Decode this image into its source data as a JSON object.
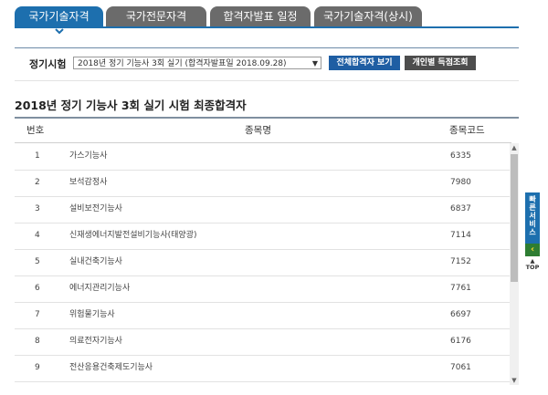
{
  "tabs": [
    {
      "label": "국가기술자격",
      "active": true
    },
    {
      "label": "국가전문자격",
      "active": false
    },
    {
      "label": "합격자발표 일정",
      "active": false
    },
    {
      "label": "국가기술자격(상시)",
      "active": false
    }
  ],
  "filter": {
    "label": "정기시험",
    "selected": "2018년 정기 기능사 3회 실기 (합격자발표일 2018.09.28)",
    "btn_all": "전체합격자 보기",
    "btn_personal": "개인별 득점조회"
  },
  "section_title": "2018년 정기 기능사 3회 실기 시험 최종합격자",
  "table": {
    "headers": {
      "no": "번호",
      "name": "종목명",
      "code": "종목코드"
    },
    "rows": [
      {
        "no": "1",
        "name": "가스기능사",
        "code": "6335"
      },
      {
        "no": "2",
        "name": "보석감정사",
        "code": "7980"
      },
      {
        "no": "3",
        "name": "설비보전기능사",
        "code": "6837"
      },
      {
        "no": "4",
        "name": "신재생에너지발전설비기능사(태양광)",
        "code": "7114"
      },
      {
        "no": "5",
        "name": "실내건축기능사",
        "code": "7152"
      },
      {
        "no": "6",
        "name": "에너지관리기능사",
        "code": "7761"
      },
      {
        "no": "7",
        "name": "위험물기능사",
        "code": "6697"
      },
      {
        "no": "8",
        "name": "의료전자기능사",
        "code": "6176"
      },
      {
        "no": "9",
        "name": "전산응용건축제도기능사",
        "code": "7061"
      }
    ]
  },
  "quick_service": {
    "label_chars": [
      "빠",
      "른",
      "서",
      "비",
      "스"
    ],
    "top": "TOP"
  },
  "colors": {
    "accent": "#1d6fae",
    "tab_inactive": "#6b6b6b",
    "primary_button": "#1f5ea3",
    "secondary_button": "#4d4d4d"
  },
  "icons": {
    "tab_caret": "chevron-down-icon",
    "select_arrow": "triangle-down-icon",
    "quick_arrow": "chevron-left-icon"
  }
}
